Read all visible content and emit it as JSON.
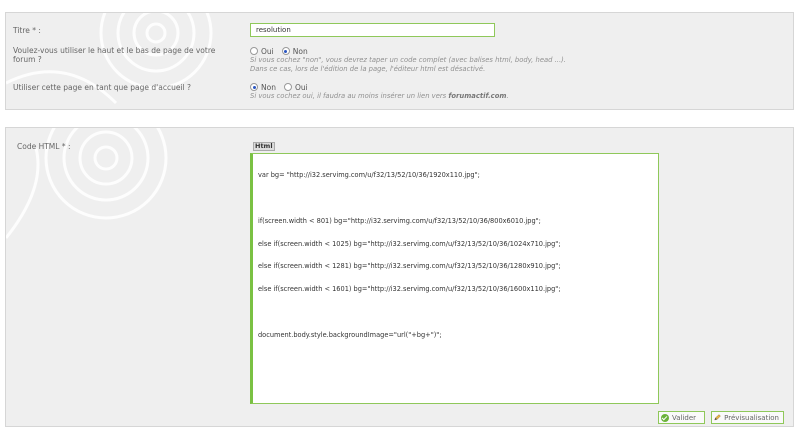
{
  "top_form": {
    "title_label": "Titre * :",
    "title_value": "resolution",
    "header_footer_label_line1": "Voulez-vous utiliser le haut et le bas de page de votre",
    "header_footer_label_line2": "forum ?",
    "header_footer_options": [
      "Oui",
      "Non"
    ],
    "header_footer_selected": "Non",
    "header_footer_help_line1": "Si vous cochez \"non\", vous devrez taper un code complet (avec balises html, body, head ...).",
    "header_footer_help_line2": "Dans ce cas, lors de l'édition de la page, l'éditeur html est désactivé.",
    "homepage_label": "Utiliser cette page en tant que page d'accueil ?",
    "homepage_options": [
      "Non",
      "Oui"
    ],
    "homepage_selected": "Non",
    "homepage_help_prefix": "Si vous cochez oui, il faudra au moins insérer un lien vers",
    "homepage_help_link": "forumactif.com",
    "homepage_help_suffix": "."
  },
  "code_form": {
    "label": "Code HTML * :",
    "editor_toggle": "Html",
    "code_lines": [
      "var bg= \"http://i32.servimg.com/u/f32/13/52/10/36/1920x110.jpg\";",
      "",
      "if(screen.width < 801) bg=\"http://i32.servimg.com/u/f32/13/52/10/36/800x6010.jpg\";",
      "else if(screen.width < 1025) bg=\"http://i32.servimg.com/u/f32/13/52/10/36/1024x710.jpg\";",
      "else if(screen.width < 1281) bg=\"http://i32.servimg.com/u/f32/13/52/10/36/1280x910.jpg\";",
      "else if(screen.width < 1601) bg=\"http://i32.servimg.com/u/f32/13/52/10/36/1600x110.jpg\";",
      "",
      "document.body.style.backgroundImage=\"url(\"+bg+\")\";"
    ]
  },
  "buttons": {
    "submit_label": "Valider",
    "preview_label": "Prévisualisation"
  },
  "colors": {
    "accent_green": "#7ac143",
    "panel_bg": "#efefef"
  }
}
